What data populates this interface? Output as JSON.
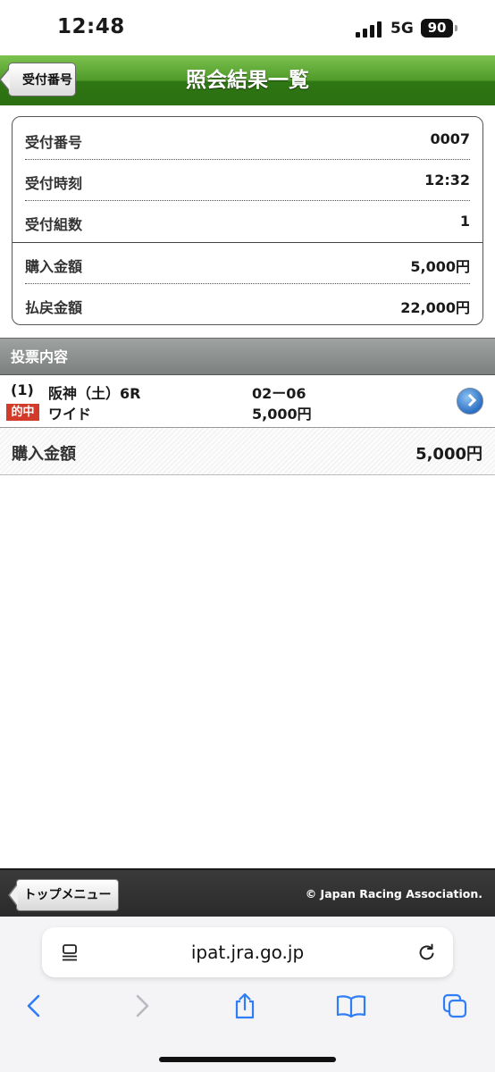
{
  "status_bar": {
    "time": "12:48",
    "network": "5G",
    "battery": "90"
  },
  "header": {
    "back_label": "受付番号",
    "title": "照会結果一覧"
  },
  "receipt": {
    "rows": [
      {
        "label": "受付番号",
        "value": "0007"
      },
      {
        "label": "受付時刻",
        "value": "12:32"
      },
      {
        "label": "受付組数",
        "value": "1"
      },
      {
        "label": "購入金額",
        "value": "5,000円"
      },
      {
        "label": "払戻金額",
        "value": "22,000円"
      }
    ]
  },
  "section": {
    "title": "投票内容"
  },
  "bet": {
    "number": "(1)",
    "race": "阪神（土）6R",
    "combination": "02ー06",
    "hit_badge": "的中",
    "bet_type": "ワイド",
    "amount": "5,000円"
  },
  "total": {
    "label": "購入金額",
    "value": "5,000円"
  },
  "footer": {
    "top_menu_label": "トップメニュー",
    "copyright": "© Japan Racing Association."
  },
  "browser": {
    "url": "ipat.jra.go.jp"
  },
  "colors": {
    "header_green": "#2f7614",
    "hit_red": "#d23a2a",
    "section_gray": "#8c908e",
    "footer_dark": "#2a2a2a"
  }
}
